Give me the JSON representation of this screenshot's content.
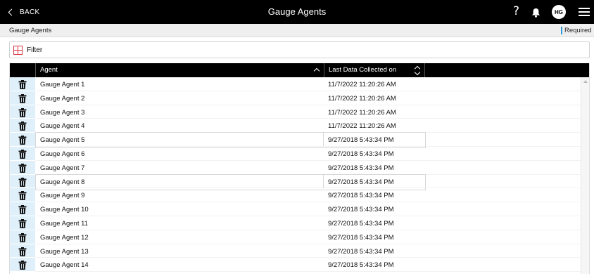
{
  "topbar": {
    "back_label": "BACK",
    "title": "Gauge Agents",
    "help_glyph": "?",
    "avatar_initials": "HG"
  },
  "subbar": {
    "breadcrumb": "Gauge Agents",
    "required_label": "Required",
    "required_color": "#2e9bd6"
  },
  "filter": {
    "label": "Filter",
    "icon": "filter-plus-icon",
    "icon_color": "#d9303e"
  },
  "grid": {
    "columns": [
      "Agent",
      "Last Data Collected on"
    ],
    "rows": [
      {
        "agent": "Gauge Agent 1",
        "last_collected": "11/7/2022 11:20:26 AM"
      },
      {
        "agent": "Gauge Agent 2",
        "last_collected": "11/7/2022 11:20:26 AM"
      },
      {
        "agent": "Gauge Agent 3",
        "last_collected": "11/7/2022 11:20:26 AM"
      },
      {
        "agent": "Gauge Agent 4",
        "last_collected": "11/7/2022 11:20:26 AM"
      },
      {
        "agent": "Gauge Agent 5",
        "last_collected": "9/27/2018 5:43:34 PM"
      },
      {
        "agent": "Gauge Agent 6",
        "last_collected": "9/27/2018 5:43:34 PM"
      },
      {
        "agent": "Gauge Agent 7",
        "last_collected": "9/27/2018 5:43:34 PM"
      },
      {
        "agent": "Gauge Agent 8",
        "last_collected": "9/27/2018 5:43:34 PM"
      },
      {
        "agent": "Gauge Agent 9",
        "last_collected": "9/27/2018 5:43:34 PM"
      },
      {
        "agent": "Gauge Agent 10",
        "last_collected": "9/27/2018 5:43:34 PM"
      },
      {
        "agent": "Gauge Agent 11",
        "last_collected": "9/27/2018 5:43:34 PM"
      },
      {
        "agent": "Gauge Agent 12",
        "last_collected": "9/27/2018 5:43:34 PM"
      },
      {
        "agent": "Gauge Agent 13",
        "last_collected": "9/27/2018 5:43:34 PM"
      },
      {
        "agent": "Gauge Agent 14",
        "last_collected": "9/27/2018 5:43:34 PM"
      }
    ],
    "row_action_icon": "trash-icon",
    "action_cell_color": "#dff0fa"
  }
}
